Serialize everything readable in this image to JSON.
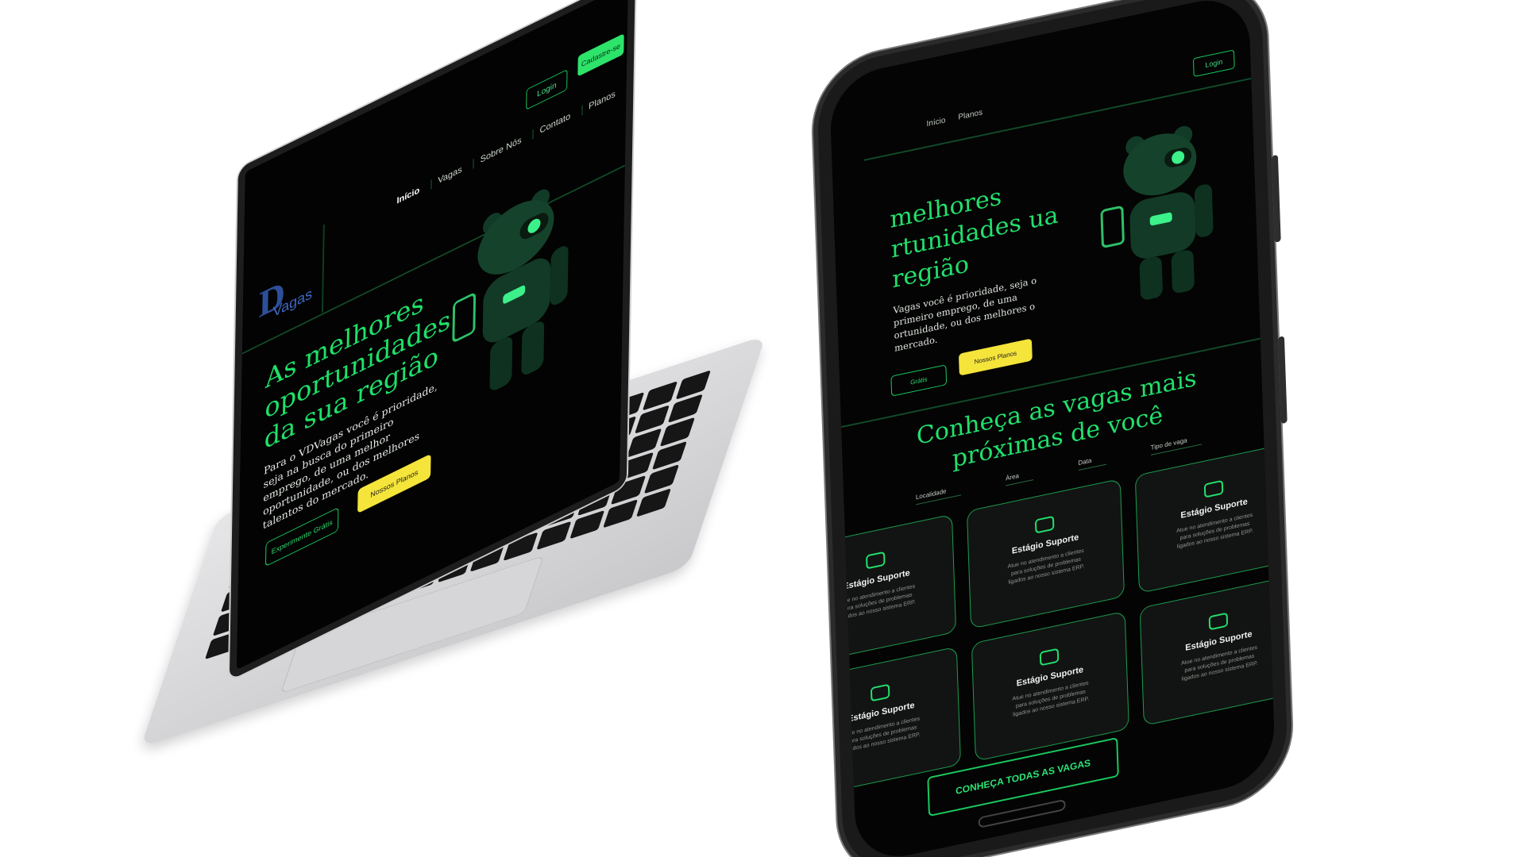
{
  "laptop": {
    "logo_big": "D",
    "logo_small": "Vagas",
    "nav": [
      "Início",
      "Vagas",
      "Sobre Nós",
      "Contato",
      "Planos"
    ],
    "login": "Login",
    "signup": "Cadastre-se",
    "hero_title": "As melhores oportunidades da sua região",
    "hero_desc": "Para o VDVagas você é prioridade, seja na busca do primeiro emprego, de uma melhor oportunidade, ou dos melhores talentos do mercado.",
    "btn_trial": "Experimente Grátis",
    "btn_plans": "Nossos Planos"
  },
  "phone": {
    "nav": [
      "Início",
      "Planos"
    ],
    "login": "Login",
    "hero_title": "melhores rtunidades ua região",
    "hero_desc": "Vagas você é prioridade, seja o primeiro emprego, de uma ortunidade, ou dos melhores o mercado.",
    "btn_trial": "Grátis",
    "btn_plans": "Nossos Planos",
    "section_title": "Conheça as vagas mais próximas de você",
    "filters": [
      "Localidade",
      "Área",
      "Data",
      "Tipo de vaga"
    ],
    "card_title": "Estágio Suporte",
    "card_desc": "Atue no atendimento a clientes para soluções de problemas ligados ao nosso sistema ERP.",
    "all_jobs": "CONHEÇA TODAS AS VAGAS"
  },
  "colors": {
    "accent": "#22df6c",
    "yellow": "#f5e43a",
    "bg": "#030403"
  }
}
